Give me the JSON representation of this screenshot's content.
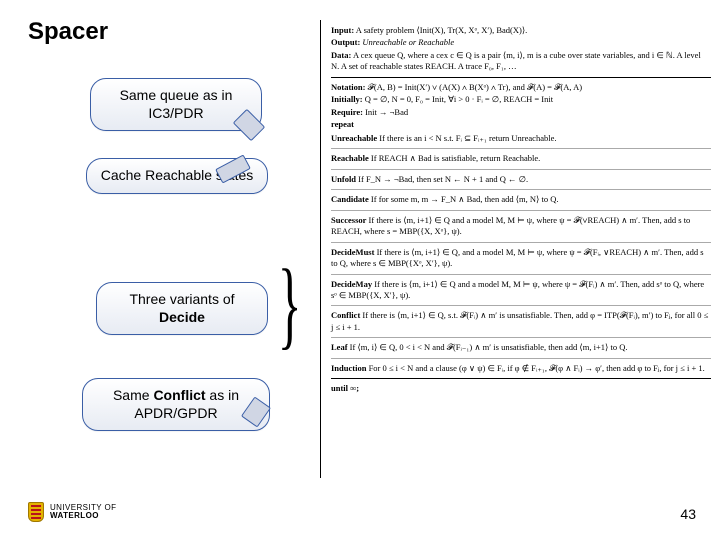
{
  "title": "Spacer",
  "callouts": {
    "c1": "Same queue as in IC3/PDR",
    "c2": "Cache Reachable states",
    "c3_a": "Three variants of ",
    "c3_b": "Decide",
    "c4_a": "Same ",
    "c4_b": "Conflict",
    "c4_c": " as in APDR/GPDR"
  },
  "algo": {
    "input_lbl": "Input:",
    "input_txt": " A safety problem ⟨Init(X), Tr(X, Xᵒ, X′), Bad(X)⟩.",
    "output_lbl": "Output:",
    "output_txt": " Unreachable or Reachable",
    "data_lbl": "Data:",
    "data_txt": " A cex queue Q, where a cex c ∈ Q is a pair ⟨m, i⟩, m is a cube over state variables, and i ∈ ℕ. A level N. A set of reachable states REACH. A trace F₀, F₁, …",
    "notation_lbl": "Notation:",
    "notation_txt": " 𝓕(A, B) = Init(X′) ∨ (A(X) ∧ B(Xᵒ) ∧ Tr), and 𝓕(A) = 𝓕(A, A)",
    "initially_lbl": "Initially:",
    "initially_txt": " Q = ∅, N = 0, F₀ = Init, ∀i > 0 · Fᵢ = ∅, REACH = Init",
    "require_lbl": "Require:",
    "require_txt": " Init → ¬Bad",
    "repeat": "repeat",
    "r_unreach_n": "Unreachable",
    "r_unreach_t": " If there is an i < N s.t. Fᵢ ⊆ Fᵢ₊₁ return Unreachable.",
    "r_reach_n": "Reachable",
    "r_reach_t": " If REACH ∧ Bad is satisfiable, return Reachable.",
    "r_unfold_n": "Unfold",
    "r_unfold_t": " If F_N → ¬Bad, then set N ← N + 1 and Q ← ∅.",
    "r_cand_n": "Candidate",
    "r_cand_t": " If for some m, m → F_N ∧ Bad, then add ⟨m, N⟩ to Q.",
    "r_succ_n": "Successor",
    "r_succ_t": " If there is ⟨m, i+1⟩ ∈ Q and a model M, M ⊨ ψ, where ψ = 𝓕(∨REACH) ∧ m′. Then, add s to REACH, where s = MBP({X, Xᵒ}, ψ).",
    "r_dmust_n": "DecideMust",
    "r_dmust_t": " If there is ⟨m, i+1⟩ ∈ Q, and a model M, M ⊨ ψ, where ψ = 𝓕(Fᵢ, ∨REACH) ∧ m′. Then, add s to Q, where s ∈ MBP({Xᵒ, X′}, ψ).",
    "r_dmay_n": "DecideMay",
    "r_dmay_t": " If there is ⟨m, i+1⟩ ∈ Q and a model M, M ⊨ ψ, where ψ = 𝓕(Fᵢ) ∧ m′. Then, add sᵒ to Q, where sᵒ ∈ MBP({X, X′}, ψ).",
    "r_conf_n": "Conflict",
    "r_conf_t": " If there is ⟨m, i+1⟩ ∈ Q, s.t. 𝓕(Fᵢ) ∧ m′ is unsatisfiable. Then, add φ = ITP(𝓕(Fᵢ), m′) to Fⱼ, for all 0 ≤ j ≤ i + 1.",
    "r_leaf_n": "Leaf",
    "r_leaf_t": " If ⟨m, i⟩ ∈ Q, 0 < i < N and 𝓕(Fᵢ₋₁) ∧ m′ is unsatisfiable, then add ⟨m, i+1⟩ to Q.",
    "r_ind_n": "Induction",
    "r_ind_t": " For 0 ≤ i < N and a clause (φ ∨ ψ) ∈ Fᵢ, if φ ∉ Fᵢ₊₁, 𝓕(φ ∧ Fᵢ) → φ′, then add φ to Fⱼ, for j ≤ i + 1.",
    "until": "until ∞;"
  },
  "footer": {
    "line1": "UNIVERSITY OF",
    "line2": "WATERLOO"
  },
  "pagenum": "43"
}
